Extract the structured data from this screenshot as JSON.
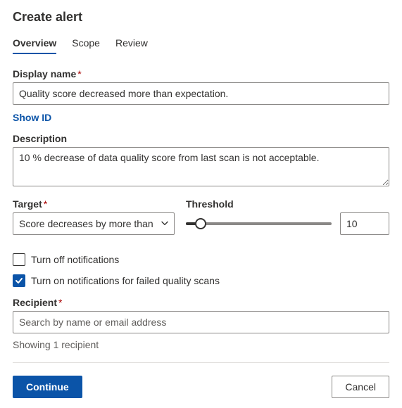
{
  "header": {
    "title": "Create alert"
  },
  "tabs": {
    "t0": "Overview",
    "t1": "Scope",
    "t2": "Review"
  },
  "fields": {
    "display_name": {
      "label": "Display name",
      "value": "Quality score decreased more than expectation."
    },
    "show_id": "Show ID",
    "description": {
      "label": "Description",
      "value": "10 % decrease of data quality score from last scan is not acceptable."
    },
    "target": {
      "label": "Target",
      "value": "Score decreases by more than"
    },
    "threshold": {
      "label": "Threshold",
      "value": "10"
    },
    "notif_off": "Turn off notifications",
    "notif_failed": "Turn on notifications for failed quality scans",
    "recipient": {
      "label": "Recipient",
      "placeholder": "Search by name or email address"
    },
    "recipient_count": "Showing 1 recipient"
  },
  "footer": {
    "continue": "Continue",
    "cancel": "Cancel"
  }
}
